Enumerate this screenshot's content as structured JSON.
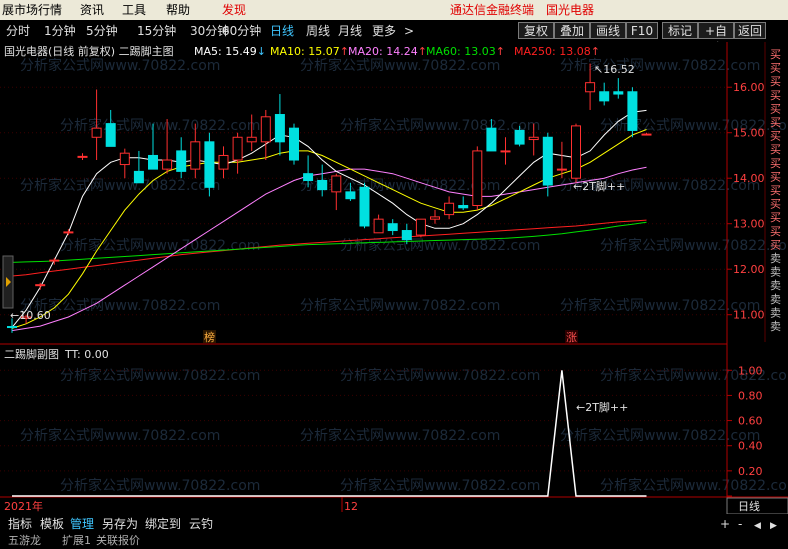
{
  "menu": {
    "items": [
      "展市场行情",
      "资讯",
      "工具",
      "帮助"
    ],
    "discover": "发现",
    "banner": "通达信金融终端",
    "stock_name": "国光电器"
  },
  "toolbar": {
    "periods": [
      "分时",
      "1分钟",
      "5分钟",
      "15分钟",
      "30分钟",
      "60分钟",
      "日线",
      "周线",
      "月线",
      "更多",
      ">"
    ],
    "active_period": "日线",
    "buttons": [
      "复权",
      "叠加",
      "画线",
      "F10",
      "标记",
      "+自选",
      "返回"
    ]
  },
  "main_chart": {
    "title": "国光电器(日线 前复权) 二踢脚主图",
    "ma": [
      {
        "label": "MA5: 15.49",
        "arrow": "↓",
        "color": "#ffffff"
      },
      {
        "label": "MA10: 15.07",
        "arrow": "↑",
        "color": "#ffff00"
      },
      {
        "label": "MA20: 14.24",
        "arrow": "↑",
        "color": "#ff80ff"
      },
      {
        "label": "MA60: 13.03",
        "arrow": "↑",
        "color": "#00e000"
      },
      {
        "label": "MA250: 13.08",
        "arrow": "↑",
        "color": "#ff2020"
      }
    ],
    "high_label": "16.52",
    "low_label": "10.60",
    "signal_label": "2T脚++",
    "markers": [
      {
        "text": "榜",
        "color": "#ffb040"
      },
      {
        "text": "涨",
        "color": "#ff5050"
      }
    ],
    "right_tags": [
      "买",
      "买",
      "买",
      "买",
      "买",
      "买",
      "买",
      "买",
      "买",
      "买",
      "买",
      "买",
      "买",
      "买",
      "买",
      "卖",
      "卖",
      "卖",
      "卖",
      "卖",
      "卖"
    ]
  },
  "sub_chart": {
    "title": "二踢脚副图",
    "value": "TT: 0.00",
    "signal_label": "2T脚++"
  },
  "axis": {
    "year": "2021年",
    "month": "12",
    "corner": "日线"
  },
  "watermark": "分析家公式网www.70822.com",
  "status": {
    "tabs": [
      "指标",
      "模板",
      "管理",
      "另存为",
      "绑定到",
      "云钓"
    ],
    "active_tab": "管理",
    "tabs2": [
      "五游龙",
      "扩展1",
      "关联报价"
    ],
    "controls": [
      "+",
      "-",
      "◀",
      "▶"
    ]
  },
  "chart_data": {
    "type": "candlestick",
    "title": "国光电器(日线 前复权) 二踢脚主图",
    "ylim": [
      10.4,
      16.95
    ],
    "yticks": [
      11,
      12,
      13,
      14,
      15,
      16
    ],
    "yticklabels": [
      "11.00",
      "12.00",
      "13.00",
      "14.00",
      "15.00",
      "16.00"
    ],
    "candles": [
      {
        "o": 10.74,
        "h": 10.92,
        "l": 10.6,
        "c": 10.72
      },
      {
        "o": 10.92,
        "h": 11.0,
        "l": 10.8,
        "c": 10.95
      },
      {
        "o": 11.64,
        "h": 11.7,
        "l": 11.55,
        "c": 11.66
      },
      {
        "o": 12.2,
        "h": 12.25,
        "l": 12.1,
        "c": 12.2
      },
      {
        "o": 12.82,
        "h": 12.88,
        "l": 12.75,
        "c": 12.82
      },
      {
        "o": 14.48,
        "h": 14.55,
        "l": 14.4,
        "c": 14.48
      },
      {
        "o": 14.9,
        "h": 15.95,
        "l": 14.4,
        "c": 15.1
      },
      {
        "o": 15.2,
        "h": 15.5,
        "l": 14.7,
        "c": 14.7
      },
      {
        "o": 14.3,
        "h": 14.65,
        "l": 14.0,
        "c": 14.55
      },
      {
        "o": 14.15,
        "h": 14.6,
        "l": 13.9,
        "c": 13.9
      },
      {
        "o": 14.5,
        "h": 15.2,
        "l": 14.2,
        "c": 14.2
      },
      {
        "o": 14.2,
        "h": 15.3,
        "l": 14.1,
        "c": 14.4
      },
      {
        "o": 14.6,
        "h": 14.9,
        "l": 14.0,
        "c": 14.15
      },
      {
        "o": 14.2,
        "h": 15.2,
        "l": 14.0,
        "c": 14.8
      },
      {
        "o": 14.8,
        "h": 15.0,
        "l": 13.6,
        "c": 13.8
      },
      {
        "o": 14.2,
        "h": 14.7,
        "l": 14.0,
        "c": 14.5
      },
      {
        "o": 14.4,
        "h": 15.0,
        "l": 14.1,
        "c": 14.9
      },
      {
        "o": 14.8,
        "h": 15.4,
        "l": 14.6,
        "c": 14.9
      },
      {
        "o": 14.8,
        "h": 15.5,
        "l": 14.4,
        "c": 15.35
      },
      {
        "o": 15.4,
        "h": 15.85,
        "l": 14.5,
        "c": 14.8
      },
      {
        "o": 15.1,
        "h": 15.2,
        "l": 14.3,
        "c": 14.4
      },
      {
        "o": 14.1,
        "h": 14.5,
        "l": 13.8,
        "c": 13.95
      },
      {
        "o": 13.95,
        "h": 14.3,
        "l": 13.6,
        "c": 13.75
      },
      {
        "o": 13.7,
        "h": 14.1,
        "l": 13.3,
        "c": 14.05
      },
      {
        "o": 13.7,
        "h": 13.9,
        "l": 13.5,
        "c": 13.55
      },
      {
        "o": 13.8,
        "h": 13.9,
        "l": 12.9,
        "c": 12.95
      },
      {
        "o": 12.8,
        "h": 13.2,
        "l": 12.8,
        "c": 13.1
      },
      {
        "o": 13.0,
        "h": 13.1,
        "l": 12.75,
        "c": 12.85
      },
      {
        "o": 12.85,
        "h": 13.0,
        "l": 12.55,
        "c": 12.65
      },
      {
        "o": 12.75,
        "h": 13.1,
        "l": 12.7,
        "c": 13.1
      },
      {
        "o": 13.1,
        "h": 13.3,
        "l": 13.0,
        "c": 13.15
      },
      {
        "o": 13.2,
        "h": 13.6,
        "l": 13.1,
        "c": 13.45
      },
      {
        "o": 13.4,
        "h": 13.6,
        "l": 13.3,
        "c": 13.35
      },
      {
        "o": 13.4,
        "h": 14.7,
        "l": 13.3,
        "c": 14.6
      },
      {
        "o": 15.1,
        "h": 15.3,
        "l": 14.6,
        "c": 14.6
      },
      {
        "o": 14.6,
        "h": 14.9,
        "l": 14.3,
        "c": 14.6
      },
      {
        "o": 15.05,
        "h": 15.15,
        "l": 14.7,
        "c": 14.75
      },
      {
        "o": 14.85,
        "h": 15.2,
        "l": 14.5,
        "c": 14.9
      },
      {
        "o": 14.9,
        "h": 15.0,
        "l": 13.6,
        "c": 13.85
      },
      {
        "o": 14.2,
        "h": 14.8,
        "l": 14.0,
        "c": 14.2
      },
      {
        "o": 14.0,
        "h": 15.2,
        "l": 13.9,
        "c": 15.15
      },
      {
        "o": 15.9,
        "h": 16.52,
        "l": 15.5,
        "c": 16.1
      },
      {
        "o": 15.9,
        "h": 16.1,
        "l": 15.6,
        "c": 15.7
      },
      {
        "o": 15.9,
        "h": 16.2,
        "l": 15.75,
        "c": 15.85
      },
      {
        "o": 15.9,
        "h": 16.0,
        "l": 14.9,
        "c": 15.05
      },
      {
        "o": 14.97,
        "h": 15.0,
        "l": 14.95,
        "c": 14.97
      }
    ],
    "ma5": [
      10.72,
      11.1,
      11.6,
      12.2,
      12.8,
      13.6,
      14.1,
      14.35,
      14.45,
      14.45,
      14.4,
      14.4,
      14.35,
      14.4,
      14.35,
      14.3,
      14.4,
      14.55,
      14.75,
      14.95,
      14.9,
      14.7,
      14.4,
      14.15,
      14.0,
      13.85,
      13.65,
      13.45,
      13.2,
      13.0,
      12.9,
      12.9,
      13.0,
      13.2,
      13.45,
      13.75,
      14.05,
      14.35,
      14.55,
      14.5,
      14.45,
      14.6,
      14.95,
      15.25,
      15.45,
      15.49
    ],
    "ma10": [
      10.7,
      10.8,
      10.95,
      11.15,
      11.45,
      11.9,
      12.4,
      12.85,
      13.3,
      13.65,
      13.95,
      14.15,
      14.25,
      14.3,
      14.35,
      14.35,
      14.35,
      14.4,
      14.45,
      14.55,
      14.6,
      14.6,
      14.5,
      14.35,
      14.2,
      14.05,
      13.9,
      13.75,
      13.6,
      13.45,
      13.35,
      13.25,
      13.25,
      13.3,
      13.4,
      13.55,
      13.7,
      13.85,
      14.0,
      14.1,
      14.2,
      14.35,
      14.55,
      14.75,
      14.95,
      15.07
    ],
    "ma20": [
      10.65,
      10.7,
      10.75,
      10.85,
      10.95,
      11.1,
      11.25,
      11.45,
      11.65,
      11.85,
      12.05,
      12.25,
      12.45,
      12.65,
      12.85,
      13.05,
      13.25,
      13.45,
      13.65,
      13.8,
      13.95,
      14.05,
      14.1,
      14.15,
      14.2,
      14.2,
      14.15,
      14.1,
      14.0,
      13.9,
      13.8,
      13.7,
      13.65,
      13.6,
      13.6,
      13.65,
      13.7,
      13.75,
      13.8,
      13.85,
      13.9,
      13.95,
      14.0,
      14.1,
      14.18,
      14.24
    ],
    "ma60": [
      12.15,
      12.16,
      12.17,
      12.18,
      12.2,
      12.22,
      12.24,
      12.26,
      12.28,
      12.3,
      12.32,
      12.34,
      12.36,
      12.38,
      12.4,
      12.42,
      12.44,
      12.46,
      12.48,
      12.5,
      12.52,
      12.54,
      12.55,
      12.56,
      12.57,
      12.58,
      12.59,
      12.6,
      12.61,
      12.62,
      12.63,
      12.64,
      12.65,
      12.66,
      12.67,
      12.68,
      12.7,
      12.72,
      12.75,
      12.78,
      12.82,
      12.86,
      12.9,
      12.95,
      12.99,
      13.03
    ],
    "ma250": [
      11.85,
      11.88,
      11.92,
      11.96,
      12.0,
      12.04,
      12.08,
      12.12,
      12.16,
      12.2,
      12.24,
      12.28,
      12.32,
      12.35,
      12.38,
      12.41,
      12.44,
      12.47,
      12.5,
      12.53,
      12.55,
      12.57,
      12.59,
      12.61,
      12.63,
      12.65,
      12.67,
      12.69,
      12.71,
      12.73,
      12.75,
      12.77,
      12.79,
      12.81,
      12.83,
      12.85,
      12.87,
      12.89,
      12.91,
      12.93,
      12.95,
      12.98,
      13.01,
      13.04,
      13.06,
      13.08
    ],
    "sub": {
      "yticks": [
        0.0,
        0.2,
        0.4,
        0.6,
        0.8,
        1.0
      ],
      "yticklabels": [
        "",
        "0.20",
        "0.40",
        "0.60",
        "0.80",
        "1.00"
      ],
      "ylim": [
        0,
        1.05
      ],
      "values": [
        0,
        0,
        0,
        0,
        0,
        0,
        0,
        0,
        0,
        0,
        0,
        0,
        0,
        0,
        0,
        0,
        0,
        0,
        0,
        0,
        0,
        0,
        0,
        0,
        0,
        0,
        0,
        0,
        0,
        0,
        0,
        0,
        0,
        0,
        0,
        0,
        0,
        0,
        0,
        1,
        0,
        0,
        0,
        0,
        0,
        0
      ]
    }
  }
}
